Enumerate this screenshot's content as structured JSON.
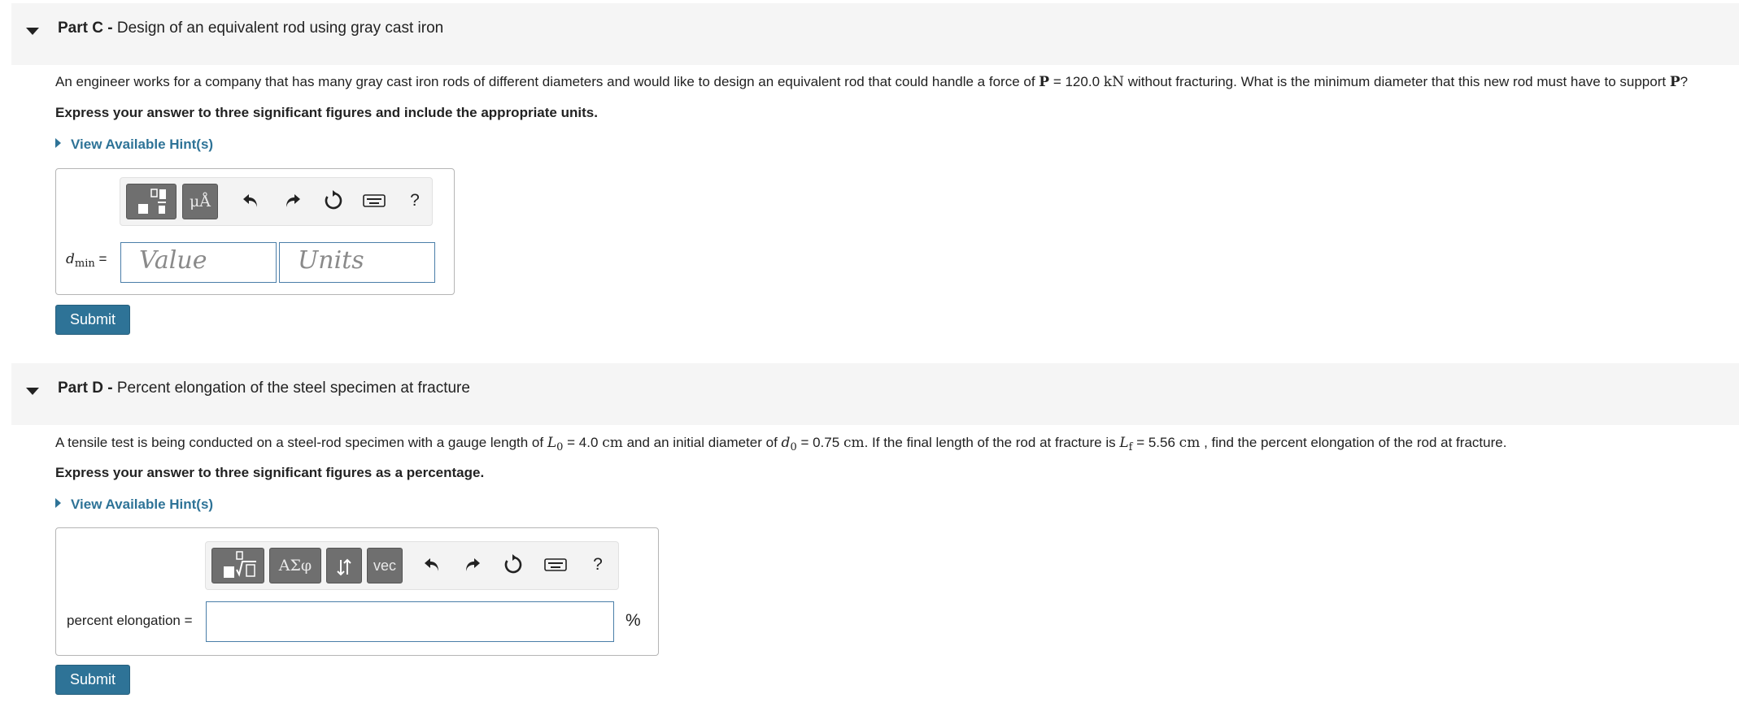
{
  "part_c": {
    "title_prefix": "Part C -",
    "title": "Design of an equivalent rod using gray cast iron",
    "problem_pre": "An engineer works for a company that has many gray cast iron rods of different diameters and would like to design an equivalent rod that could handle a force of",
    "P_symbol": "P",
    "P_value": "= 120.0",
    "P_unit": "kN",
    "problem_post": "without fracturing. What is the minimum diameter that this new rod must have to support",
    "P_symbol_end": "P",
    "question_mark": "?",
    "instruction": "Express your answer to three significant figures and include the appropriate units.",
    "hint_label": "View Available Hint(s)",
    "answer_label_var": "d",
    "answer_label_sub": "min",
    "answer_label_eq": "=",
    "value_placeholder": "Value",
    "units_placeholder": "Units",
    "mu_button": "μÅ",
    "help": "?",
    "submit": "Submit"
  },
  "part_d": {
    "title_prefix": "Part D -",
    "title": "Percent elongation of the steel specimen at fracture",
    "p1": "A tensile test is being conducted on a steel-rod specimen with a gauge length of",
    "L0_var": "L",
    "L0_sub": "0",
    "L0_val": "= 4.0",
    "unit_cm1": "cm",
    "p2": "and an initial diameter of",
    "d0_var": "d",
    "d0_sub": "0",
    "d0_val": "= 0.75",
    "unit_cm2": "cm",
    "p3": ". If the final length of the rod at fracture is",
    "Lf_var": "L",
    "Lf_sub": "f",
    "Lf_val": "= 5.56",
    "unit_cm3": "cm",
    "p4": ", find the percent elongation of the rod at fracture.",
    "instruction": "Express your answer to three significant figures as a percentage.",
    "hint_label": "View Available Hint(s)",
    "greek_button": "ΑΣφ",
    "vec_button": "vec",
    "help": "?",
    "answer_label": "percent elongation =",
    "answer_unit": "%",
    "submit": "Submit"
  }
}
